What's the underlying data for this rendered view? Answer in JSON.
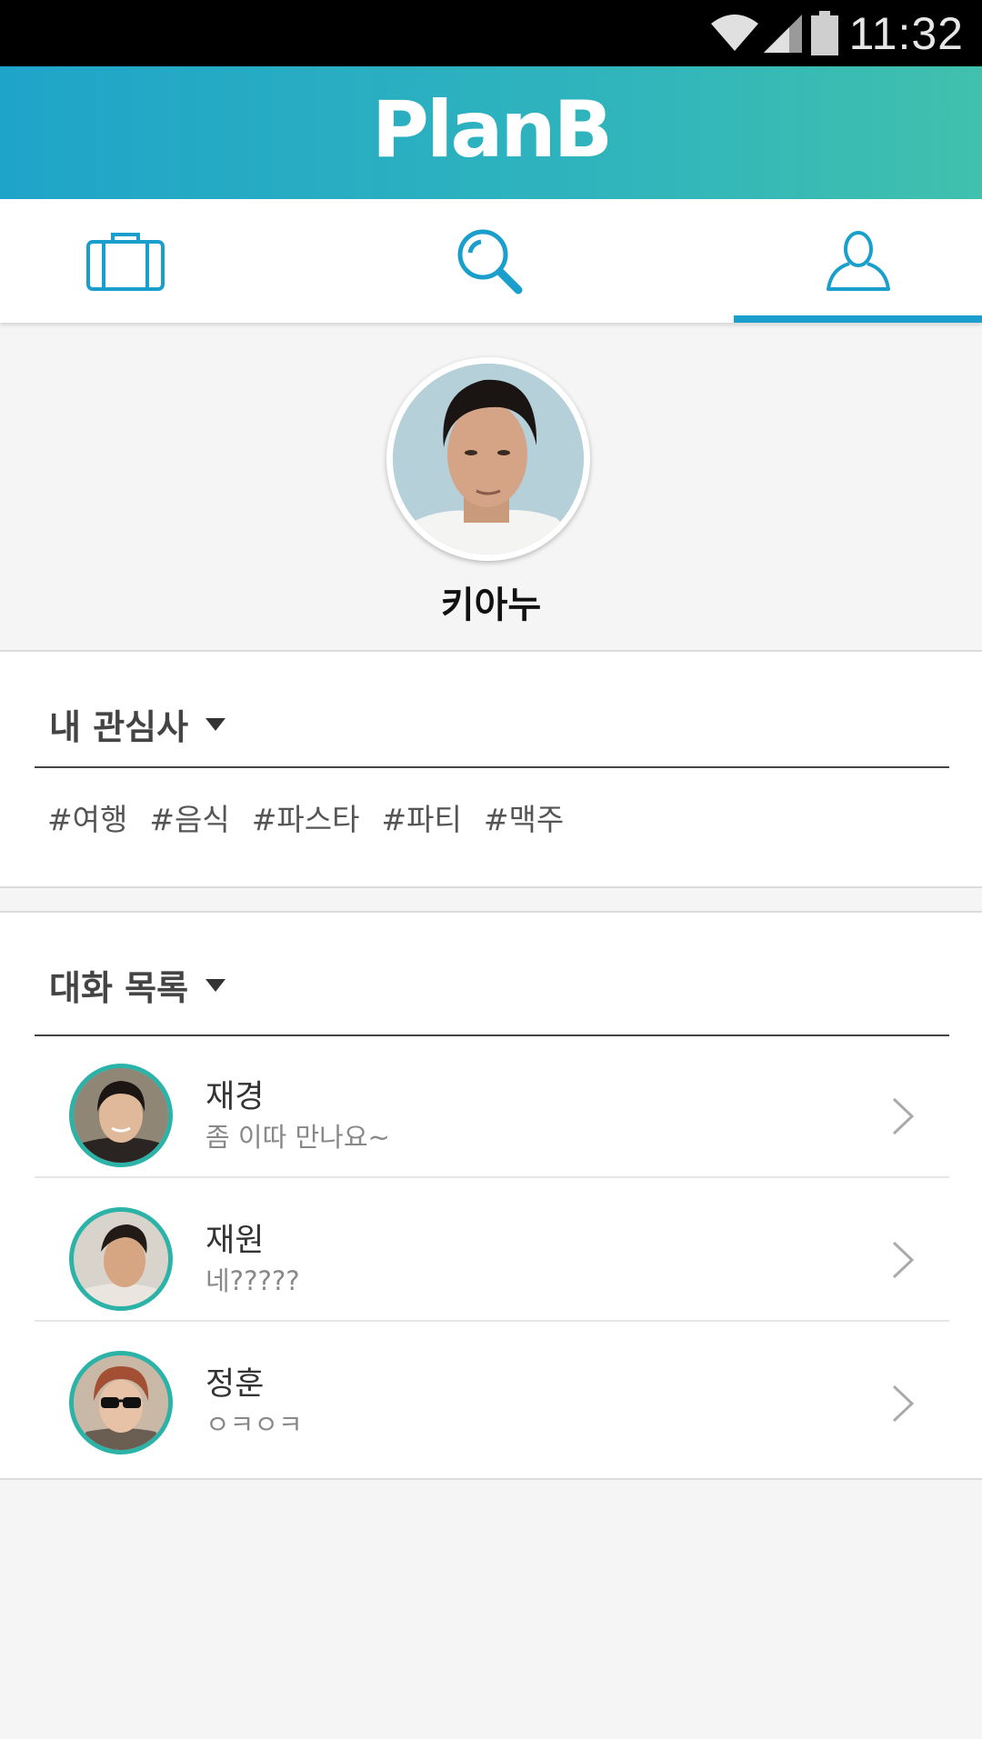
{
  "status_bar": {
    "time": "11:32",
    "icons": [
      "wifi-icon",
      "signal-icon",
      "battery-icon"
    ]
  },
  "header": {
    "brand": "PlanB",
    "gradient_colors": [
      "#1fa4c9",
      "#40c0ad"
    ]
  },
  "tabs": [
    {
      "name": "trips",
      "icon": "suitcase-icon",
      "selected": false
    },
    {
      "name": "search",
      "icon": "search-icon",
      "selected": false
    },
    {
      "name": "profile",
      "icon": "user-icon",
      "selected": true
    }
  ],
  "accent_color": "#1a9fcc",
  "profile": {
    "name": "키아누"
  },
  "interests": {
    "title": "내 관심사",
    "tags": [
      "#여행",
      "#음식",
      "#파스타",
      "#파티",
      "#맥주"
    ]
  },
  "chats": {
    "title": "대화 목록",
    "items": [
      {
        "name": "재경",
        "preview": "좀 이따 만나요~"
      },
      {
        "name": "재원",
        "preview": "네?????"
      },
      {
        "name": "정훈",
        "preview": "ㅇㅋㅇㅋ"
      }
    ]
  }
}
